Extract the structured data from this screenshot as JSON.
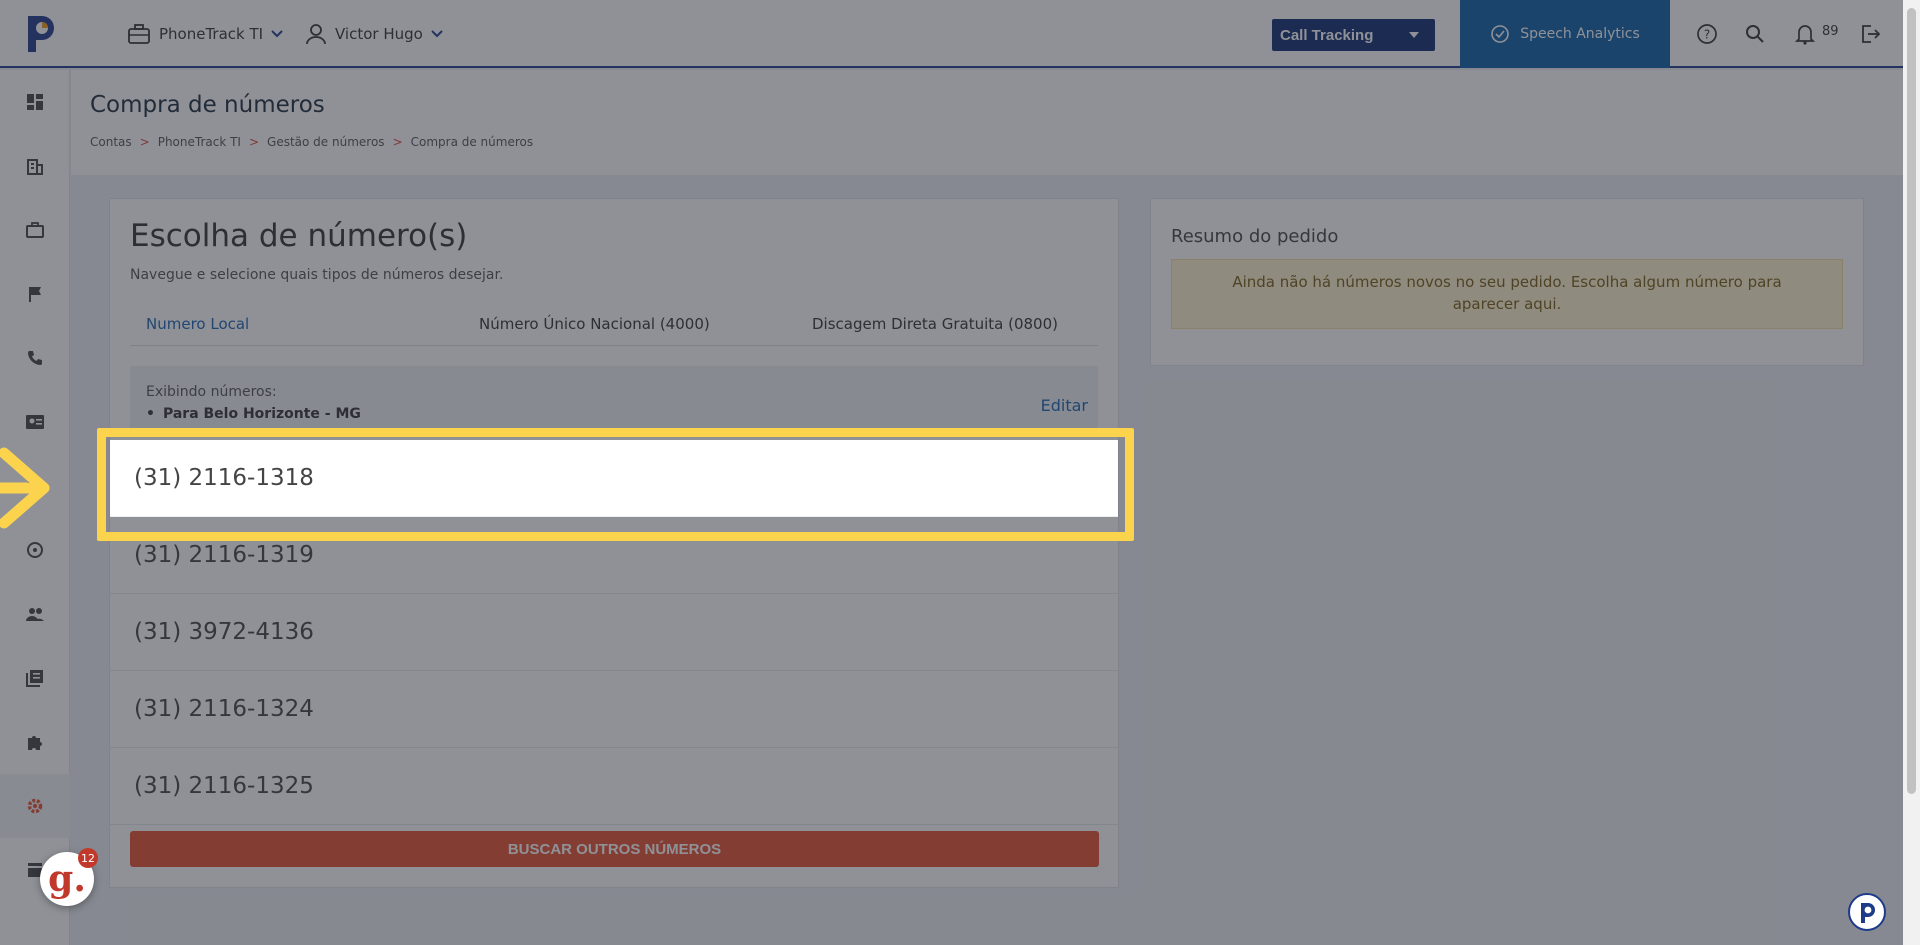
{
  "header": {
    "company_menu": "PhoneTrack TI",
    "user_menu": "Victor Hugo",
    "product_select": "Call Tracking",
    "speech_button": "Speech Analytics",
    "notifications_count": "89"
  },
  "page": {
    "title": "Compra de números",
    "breadcrumb": [
      "Contas",
      "PhoneTrack TI",
      "Gestão de números",
      "Compra de números"
    ],
    "breadcrumb_sep": ">"
  },
  "card": {
    "title": "Escolha de número(s)",
    "subtitle": "Navegue e selecione quais tipos de números desejar.",
    "tabs": [
      "Numero Local",
      "Número Único Nacional (4000)",
      "Discagem Direta Gratuita (0800)"
    ],
    "filter_label": "Exibindo números:",
    "filter_item": "Para Belo Horizonte - MG",
    "edit_link": "Editar",
    "numbers": [
      "(31) 2116-1318",
      "(31) 2116-1319",
      "(31) 3972-4136",
      "(31) 2116-1324",
      "(31) 2116-1325"
    ],
    "search_button": "BUSCAR OUTROS NÚMEROS"
  },
  "summary": {
    "title": "Resumo do pedido",
    "note": "Ainda não há números novos no seu pedido. Escolha algum número para aparecer aqui."
  },
  "widget": {
    "letter": "g.",
    "count": "12"
  },
  "colors": {
    "brand_navy": "#0d2a6e",
    "speech_blue": "#0b5ea6",
    "link_blue": "#1a63b0",
    "accent_orange": "#e8502e",
    "highlight_yellow": "#fcd34d"
  }
}
